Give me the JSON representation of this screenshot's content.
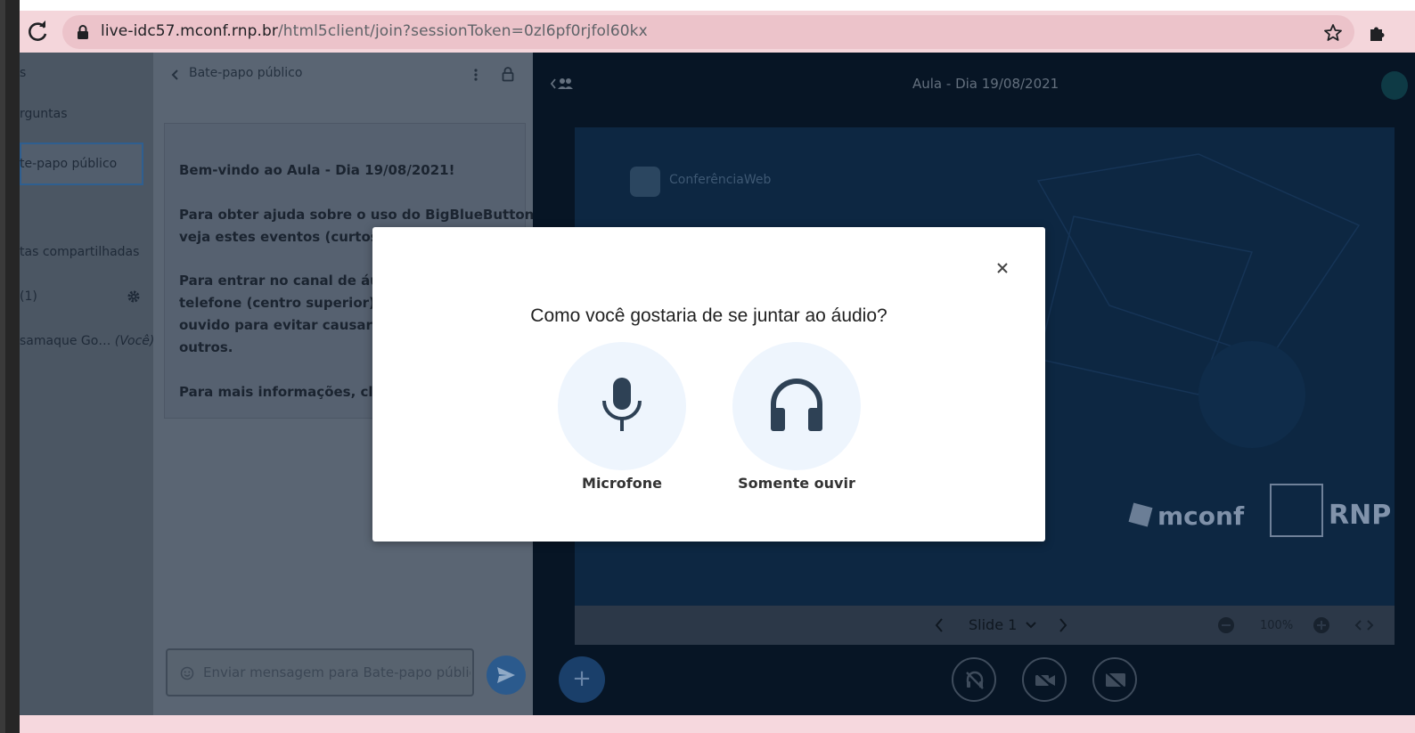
{
  "browser": {
    "url_host": "live-idc57.mconf.rnp.br",
    "url_path": "/html5client/join?sessionToken=0zl6pf0rjfol60kx"
  },
  "sidebar": {
    "items": [
      {
        "label": "s"
      },
      {
        "label": "rguntas"
      },
      {
        "label": "te-papo público"
      },
      {
        "label": "tas compartilhadas"
      },
      {
        "label": "(1)"
      },
      {
        "label": "samaque Go…",
        "suffix": "(Você)"
      }
    ]
  },
  "chat": {
    "title": "Bate-papo público",
    "messages": [
      "Bem-vindo ao Aula - Dia 19/08/2021!",
      "Para obter ajuda sobre o uso do BigBlueButton,",
      "veja estes eventos (curtos) vi",
      "Para entrar no canal de áudio",
      "telefone (centro superior). U",
      "ouvido para evitar causar ru",
      "outros.",
      "Para mais informações, cliqu"
    ],
    "input_placeholder": "Enviar mensagem para Bate-papo público"
  },
  "presentation": {
    "title": "Aula - Dia 19/08/2021",
    "slide_logo_text": "ConferênciaWeb",
    "slide_brand_1": "mconf",
    "slide_brand_2": "RNP",
    "slide_label": "Slide 1",
    "zoom": "100%"
  },
  "modal": {
    "title": "Como você gostaria de se juntar ao áudio?",
    "options": [
      {
        "label": "Microfone",
        "icon": "microphone-icon"
      },
      {
        "label": "Somente ouvir",
        "icon": "headphones-icon"
      }
    ]
  },
  "colors": {
    "modal_option_bg": "#eef5fd",
    "modal_icon": "#2e4155",
    "browser_bar": "#f4d6db"
  }
}
